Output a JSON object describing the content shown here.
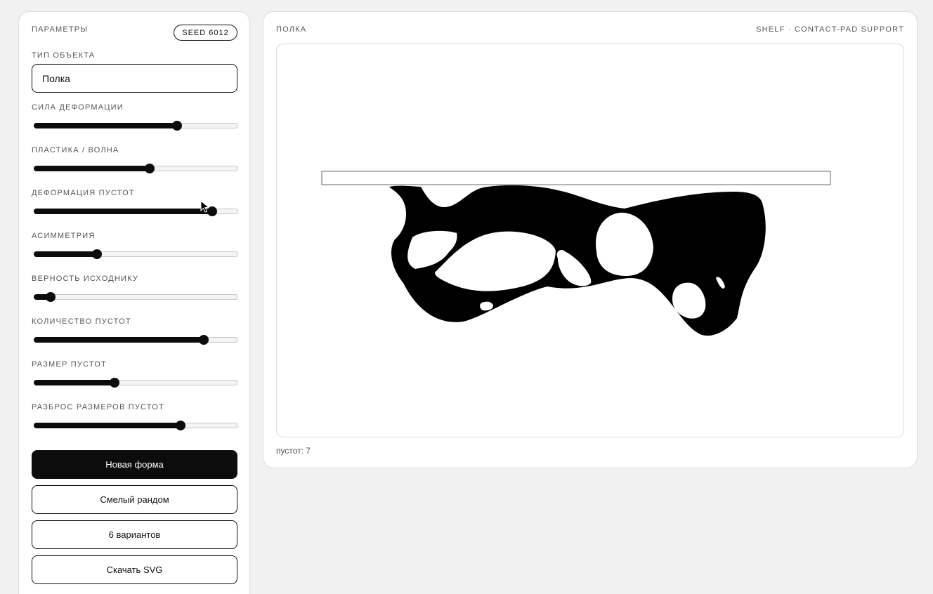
{
  "params": {
    "title": "ПАРАМЕТРЫ",
    "seed_label": "SEED 6012",
    "object_type_label": "ТИП ОБЪЕКТА",
    "object_type_value": "Полка",
    "sliders": [
      {
        "label": "СИЛА ДЕФОРМАЦИИ",
        "value": 0.71
      },
      {
        "label": "ПЛАСТИКА / ВОЛНА",
        "value": 0.57
      },
      {
        "label": "ДЕФОРМАЦИЯ ПУСТОТ",
        "value": 0.89
      },
      {
        "label": "АСИММЕТРИЯ",
        "value": 0.3
      },
      {
        "label": "ВЕРНОСТЬ ИСХОДНИКУ",
        "value": 0.06
      },
      {
        "label": "КОЛИЧЕСТВО ПУСТОТ",
        "value": 0.85
      },
      {
        "label": "РАЗМЕР ПУСТОТ",
        "value": 0.39
      },
      {
        "label": "РАЗБРОС РАЗМЕРОВ ПУСТОТ",
        "value": 0.73
      }
    ],
    "buttons": {
      "new_shape": "Новая форма",
      "bold_random": "Смелый рандом",
      "six_variants": "6 вариантов",
      "download_svg": "Скачать SVG"
    }
  },
  "preview": {
    "title": "ПОЛКА",
    "subtitle": "SHELF · CONTACT-PAD SUPPORT",
    "status": "пустот: 7"
  }
}
